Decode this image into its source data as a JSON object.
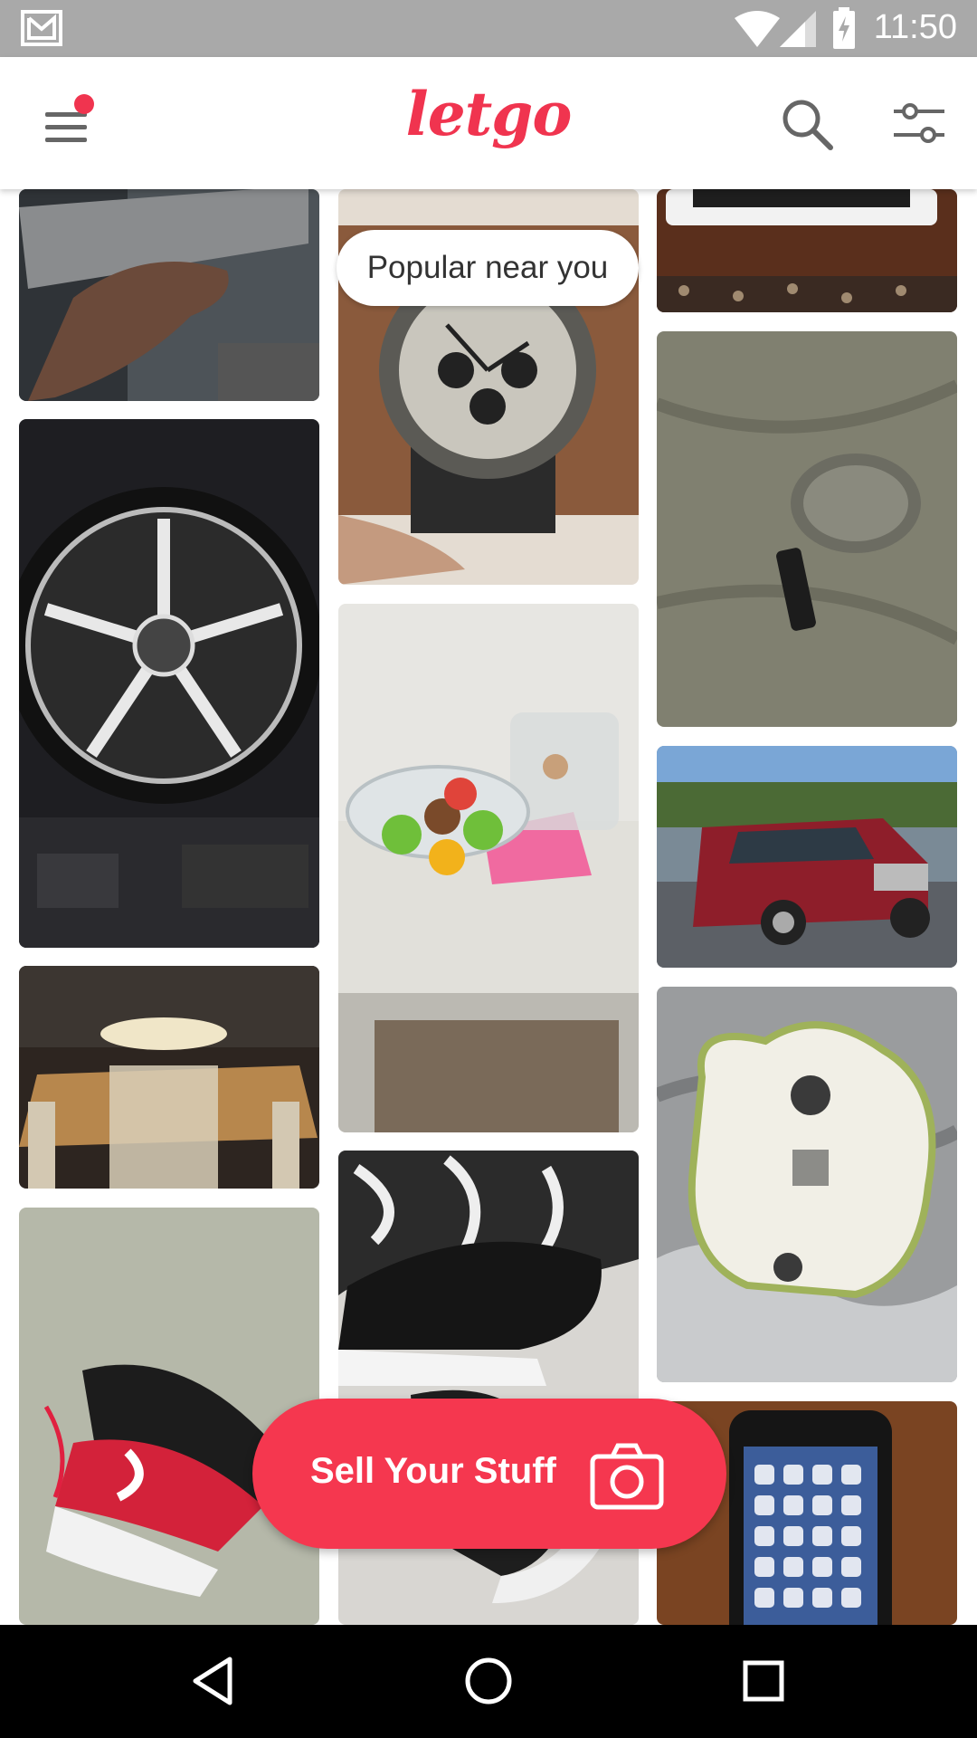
{
  "status_bar": {
    "time": "11:50",
    "icons": [
      "gmail-icon",
      "wifi-icon",
      "signal-icon",
      "battery-charging-icon"
    ]
  },
  "app_bar": {
    "logo_text": "letgo",
    "menu_icon": "hamburger-menu-icon",
    "search_icon": "search-icon",
    "filter_icon": "filter-sliders-icon"
  },
  "feed": {
    "popular_label": "Popular near you",
    "items": [
      "speaker",
      "wheel-rim",
      "dining-table",
      "sneakers-red",
      "wristwatch",
      "fruit-bowl",
      "black-sneakers",
      "tablet",
      "fur-accessory",
      "red-car",
      "ceramic-figurine",
      "smartphone"
    ]
  },
  "sell_button": {
    "label": "Sell Your Stuff",
    "icon": "camera-icon"
  },
  "nav_bar": {
    "icons": [
      "back-icon",
      "home-icon",
      "recents-icon"
    ]
  },
  "colors": {
    "brand": "#f0344f",
    "status_bar": "#a9a9a9",
    "nav_bar": "#000000"
  }
}
